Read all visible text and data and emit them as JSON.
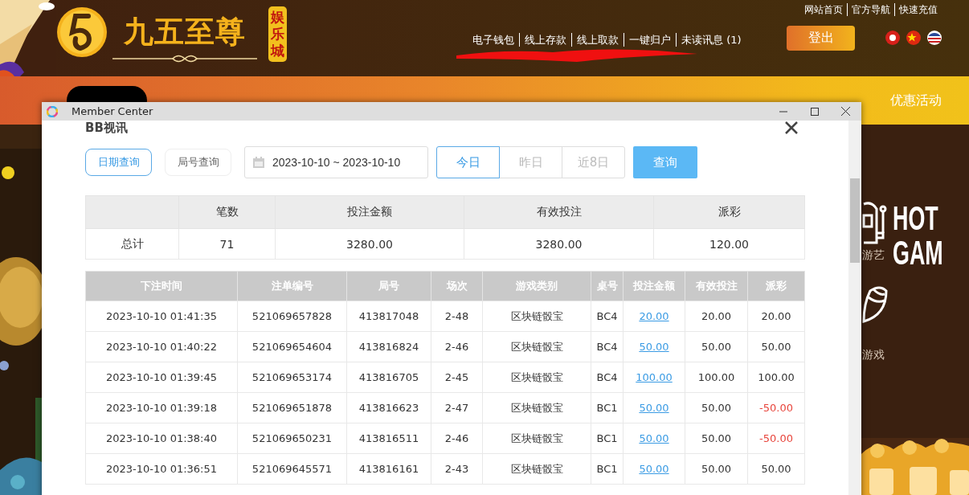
{
  "site_header": {
    "brand": "九五至尊",
    "brand_badge": "娱乐城",
    "top_links": [
      "网站首页",
      "官方导航",
      "快速充值"
    ],
    "account_links": [
      "电子钱包",
      "线上存款",
      "线上取款",
      "一键归户",
      "未读讯息 (1)"
    ],
    "logout_button": "登出"
  },
  "nav": [
    {
      "label": "优惠活动",
      "selected": false
    }
  ],
  "side_promo": {
    "categories": [
      "游艺",
      "游戏"
    ],
    "headline": [
      "HOT",
      "GAM"
    ]
  },
  "window": {
    "title": "Member Center",
    "section_title": "BB视讯",
    "query_modes": [
      {
        "label": "日期查询",
        "selected": true
      },
      {
        "label": "局号查询",
        "selected": false
      }
    ],
    "date_range": "2023-10-10 ~ 2023-10-10",
    "quick_ranges": [
      {
        "label": "今日",
        "selected": true
      },
      {
        "label": "昨日",
        "selected": false
      },
      {
        "label": "近8日",
        "selected": false
      }
    ],
    "search_button": "查询",
    "summary": {
      "columns": [
        "笔数",
        "投注金额",
        "有效投注",
        "派彩"
      ],
      "rows": [
        {
          "label": "总计",
          "values": [
            "71",
            "3280.00",
            "3280.00",
            "120.00"
          ]
        }
      ]
    },
    "table": {
      "columns": [
        "下注时间",
        "注单编号",
        "局号",
        "场次",
        "游戏类别",
        "桌号",
        "投注金额",
        "有效投注",
        "派彩"
      ],
      "rows": [
        {
          "bet_time": "2023-10-10 01:41:35",
          "ticket_no": "521069657828",
          "round_no": "413817048",
          "session": "2-48",
          "game_type": "区块链骰宝",
          "table": "BC4",
          "bet_amount": "20.00",
          "valid_bet": "20.00",
          "payout": "20.00",
          "loss": false
        },
        {
          "bet_time": "2023-10-10 01:40:22",
          "ticket_no": "521069654604",
          "round_no": "413816824",
          "session": "2-46",
          "game_type": "区块链骰宝",
          "table": "BC4",
          "bet_amount": "50.00",
          "valid_bet": "50.00",
          "payout": "50.00",
          "loss": false
        },
        {
          "bet_time": "2023-10-10 01:39:45",
          "ticket_no": "521069653174",
          "round_no": "413816705",
          "session": "2-45",
          "game_type": "区块链骰宝",
          "table": "BC4",
          "bet_amount": "100.00",
          "valid_bet": "100.00",
          "payout": "100.00",
          "loss": false
        },
        {
          "bet_time": "2023-10-10 01:39:18",
          "ticket_no": "521069651878",
          "round_no": "413816623",
          "session": "2-47",
          "game_type": "区块链骰宝",
          "table": "BC1",
          "bet_amount": "50.00",
          "valid_bet": "50.00",
          "payout": "-50.00",
          "loss": true
        },
        {
          "bet_time": "2023-10-10 01:38:40",
          "ticket_no": "521069650231",
          "round_no": "413816511",
          "session": "2-46",
          "game_type": "区块链骰宝",
          "table": "BC1",
          "bet_amount": "50.00",
          "valid_bet": "50.00",
          "payout": "-50.00",
          "loss": true
        },
        {
          "bet_time": "2023-10-10 01:36:51",
          "ticket_no": "521069645571",
          "round_no": "413816161",
          "session": "2-43",
          "game_type": "区块链骰宝",
          "table": "BC1",
          "bet_amount": "50.00",
          "valid_bet": "50.00",
          "payout": "50.00",
          "loss": false
        }
      ]
    }
  }
}
